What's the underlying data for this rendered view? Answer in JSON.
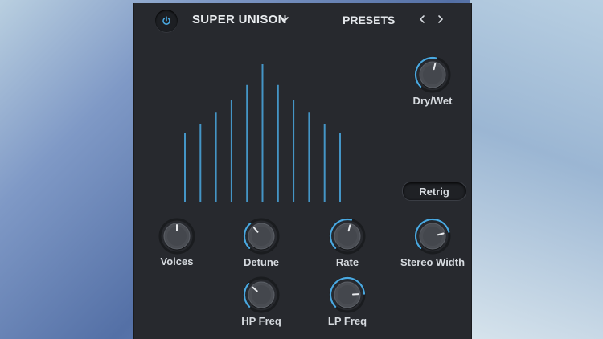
{
  "header": {
    "preset_name": "SUPER UNISON",
    "presets_label": "PRESETS"
  },
  "colors": {
    "accent": "#4aa8e0",
    "panel": "#27292e",
    "text": "#d6dadf"
  },
  "icons": {
    "power": "power-icon",
    "dropdown": "chevron-down-icon",
    "prev": "chevron-left-icon",
    "next": "chevron-right-icon"
  },
  "unison_display": {
    "voice_levels": [
      0.5,
      0.57,
      0.65,
      0.74,
      0.85,
      1.0,
      0.85,
      0.74,
      0.65,
      0.57,
      0.5
    ]
  },
  "knobs": {
    "dry_wet": {
      "label": "Dry/Wet",
      "value": 0.55
    },
    "voices": {
      "label": "Voices",
      "value": 0.5
    },
    "detune": {
      "label": "Detune",
      "value": 0.35
    },
    "rate": {
      "label": "Rate",
      "value": 0.55
    },
    "stereo_width": {
      "label": "Stereo Width",
      "value": 0.78
    },
    "hp_freq": {
      "label": "HP Freq",
      "value": 0.32
    },
    "lp_freq": {
      "label": "LP Freq",
      "value": 0.82
    }
  },
  "retrig": {
    "label": "Retrig"
  }
}
